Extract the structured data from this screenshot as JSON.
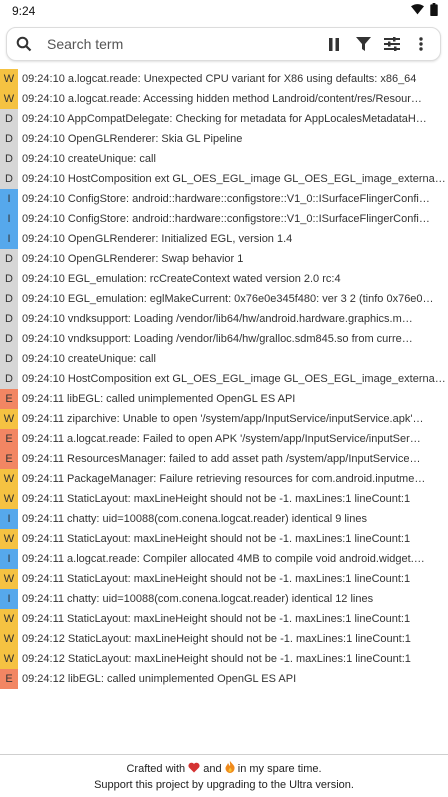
{
  "status_bar": {
    "time": "9:24"
  },
  "search": {
    "placeholder": "Search term"
  },
  "toolbar_icons": [
    "pause-icon",
    "filter-icon",
    "tune-icon",
    "more-vert-icon"
  ],
  "colors": {
    "W": "#f5c242",
    "D": "#d6d6d6",
    "I": "#56a8ec",
    "E": "#f28663"
  },
  "logs": [
    {
      "level": "W",
      "text": "09:24:10 a.logcat.reade: Unexpected CPU variant for X86 using defaults: x86_64"
    },
    {
      "level": "W",
      "text": "09:24:10 a.logcat.reade: Accessing hidden method Landroid/content/res/Resour…"
    },
    {
      "level": "D",
      "text": "09:24:10 AppCompatDelegate: Checking for metadata for AppLocalesMetadataH…"
    },
    {
      "level": "D",
      "text": "09:24:10 OpenGLRenderer: Skia GL Pipeline"
    },
    {
      "level": "D",
      "text": "09:24:10 createUnique: call"
    },
    {
      "level": "D",
      "text": "09:24:10 HostComposition ext GL_OES_EGL_image GL_OES_EGL_image_external…"
    },
    {
      "level": "I",
      "text": "09:24:10 ConfigStore: android::hardware::configstore::V1_0::ISurfaceFlingerConfi…"
    },
    {
      "level": "I",
      "text": "09:24:10 ConfigStore: android::hardware::configstore::V1_0::ISurfaceFlingerConfi…"
    },
    {
      "level": "I",
      "text": "09:24:10 OpenGLRenderer: Initialized EGL, version 1.4"
    },
    {
      "level": "D",
      "text": "09:24:10 OpenGLRenderer: Swap behavior 1"
    },
    {
      "level": "D",
      "text": "09:24:10 EGL_emulation: rcCreateContext wated version 2.0  rc:4"
    },
    {
      "level": "D",
      "text": "09:24:10 EGL_emulation: eglMakeCurrent: 0x76e0e345f480: ver 3 2 (tinfo 0x76e0…"
    },
    {
      "level": "D",
      "text": "09:24:10 vndksupport: Loading /vendor/lib64/hw/android.hardware.graphics.m…"
    },
    {
      "level": "D",
      "text": "09:24:10 vndksupport: Loading /vendor/lib64/hw/gralloc.sdm845.so from curre…"
    },
    {
      "level": "D",
      "text": "09:24:10 createUnique: call"
    },
    {
      "level": "D",
      "text": "09:24:10 HostComposition ext GL_OES_EGL_image GL_OES_EGL_image_external…"
    },
    {
      "level": "E",
      "text": "09:24:11 libEGL: called unimplemented OpenGL ES API"
    },
    {
      "level": "W",
      "text": "09:24:11 ziparchive: Unable to open '/system/app/InputService/inputService.apk'…"
    },
    {
      "level": "E",
      "text": "09:24:11 a.logcat.reade: Failed to open APK '/system/app/InputService/inputSer…"
    },
    {
      "level": "E",
      "text": "09:24:11 ResourcesManager: failed to add asset path /system/app/InputService…"
    },
    {
      "level": "W",
      "text": "09:24:11 PackageManager: Failure retrieving resources for com.android.inputme…"
    },
    {
      "level": "W",
      "text": "09:24:11 StaticLayout: maxLineHeight should not be -1.  maxLines:1 lineCount:1"
    },
    {
      "level": "I",
      "text": "09:24:11 chatty: uid=10088(com.conena.logcat.reader) identical 9 lines"
    },
    {
      "level": "W",
      "text": "09:24:11 StaticLayout: maxLineHeight should not be -1.  maxLines:1 lineCount:1"
    },
    {
      "level": "I",
      "text": "09:24:11 a.logcat.reade: Compiler allocated 4MB to compile void android.widget.…"
    },
    {
      "level": "W",
      "text": "09:24:11 StaticLayout: maxLineHeight should not be -1.  maxLines:1 lineCount:1"
    },
    {
      "level": "I",
      "text": "09:24:11 chatty: uid=10088(com.conena.logcat.reader) identical 12 lines"
    },
    {
      "level": "W",
      "text": "09:24:11 StaticLayout: maxLineHeight should not be -1.  maxLines:1 lineCount:1"
    },
    {
      "level": "W",
      "text": "09:24:12 StaticLayout: maxLineHeight should not be -1.  maxLines:1 lineCount:1"
    },
    {
      "level": "W",
      "text": "09:24:12 StaticLayout: maxLineHeight should not be -1.  maxLines:1 lineCount:1"
    },
    {
      "level": "E",
      "text": "09:24:12 libEGL: called unimplemented OpenGL ES API"
    }
  ],
  "footer": {
    "line1_before": "Crafted with",
    "line1_middle": "and",
    "line1_after": "in my spare time.",
    "line2": "Support this project by upgrading to the Ultra version."
  }
}
